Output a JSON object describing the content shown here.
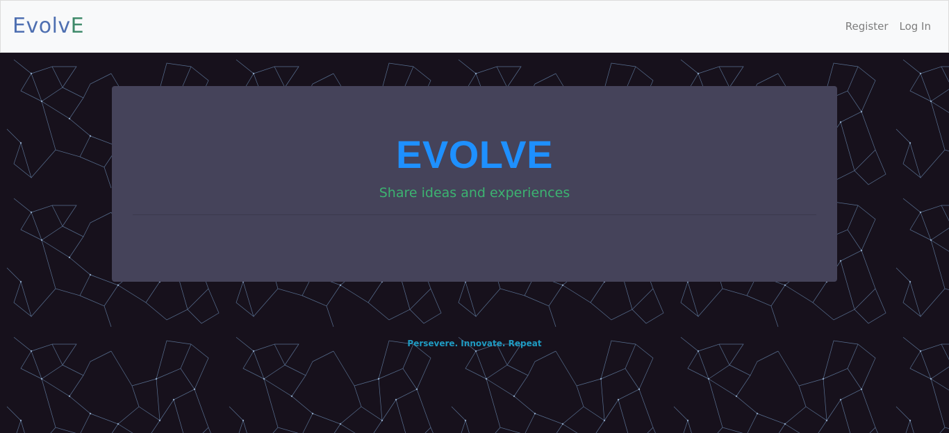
{
  "navbar": {
    "brand_part1": "Evolv",
    "brand_part2": "E",
    "links": [
      "Register",
      "Log In"
    ]
  },
  "hero": {
    "title": "EVOLVE",
    "subtitle": "Share ideas and experiences"
  },
  "footer": {
    "tagline": "Persevere. Innovate. Repeat"
  },
  "colors": {
    "background": "#17111c",
    "hero_background": "#45435a",
    "title": "#1e90ff",
    "subtitle": "#3cb371",
    "tagline": "#1f9bc2",
    "network_lines": "#6d8fb8"
  }
}
